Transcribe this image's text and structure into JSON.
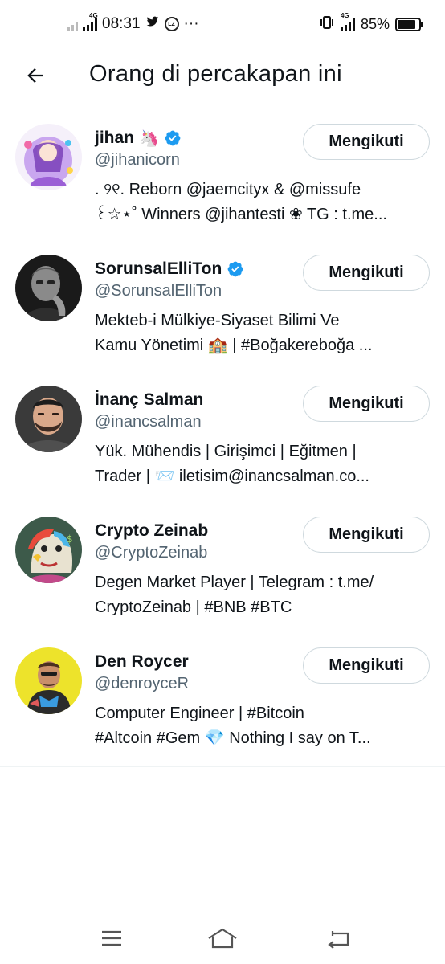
{
  "status_bar": {
    "network_left": "4G",
    "time": "08:31",
    "more": "···",
    "network_right": "4G",
    "battery_percent": "85%",
    "battery_level": 0.85
  },
  "header": {
    "title": "Orang di percakapan ini"
  },
  "users": [
    {
      "name": "jihan",
      "name_emoji": "🦄",
      "verified": true,
      "handle": "@jihanicorn",
      "bio_line1": ". ୨୧.  Reborn @jaemcityx & @missufe",
      "bio_line2": "꒰☆⋆˚ Winners @jihantesti ❀ TG : t.me...",
      "follow_label": "Mengikuti"
    },
    {
      "name": "SorunsalElliTon",
      "name_emoji": "",
      "verified": true,
      "handle": "@SorunsalElliTon",
      "bio_line1": "Mekteb-i Mülkiye-Siyaset Bilimi Ve",
      "bio_line2": "Kamu Yönetimi 🏫 | #Boğakereboğa ...",
      "follow_label": "Mengikuti"
    },
    {
      "name": "İnanç Salman",
      "name_emoji": "",
      "verified": false,
      "handle": "@inancsalman",
      "bio_line1": "Yük. Mühendis | Girişimci | Eğitmen |",
      "bio_line2": "Trader | 📨 iletisim@inancsalman.co...",
      "follow_label": "Mengikuti"
    },
    {
      "name": "Crypto Zeinab",
      "name_emoji": "",
      "verified": false,
      "handle": "@CryptoZeinab",
      "bio_line1": "Degen Market Player | Telegram : t.me/",
      "bio_line2": "CryptoZeinab | #BNB #BTC",
      "follow_label": "Mengikuti"
    },
    {
      "name": "Den Roycer",
      "name_emoji": "",
      "verified": false,
      "handle": "@denroyceR",
      "bio_line1": "Computer Engineer | #Bitcoin",
      "bio_line2": "#Altcoin #Gem 💎 Nothing I say on T...",
      "follow_label": "Mengikuti"
    }
  ],
  "colors": {
    "verified": "#1d9bf0",
    "secondary_text": "#536471",
    "border": "#cfd9de"
  }
}
